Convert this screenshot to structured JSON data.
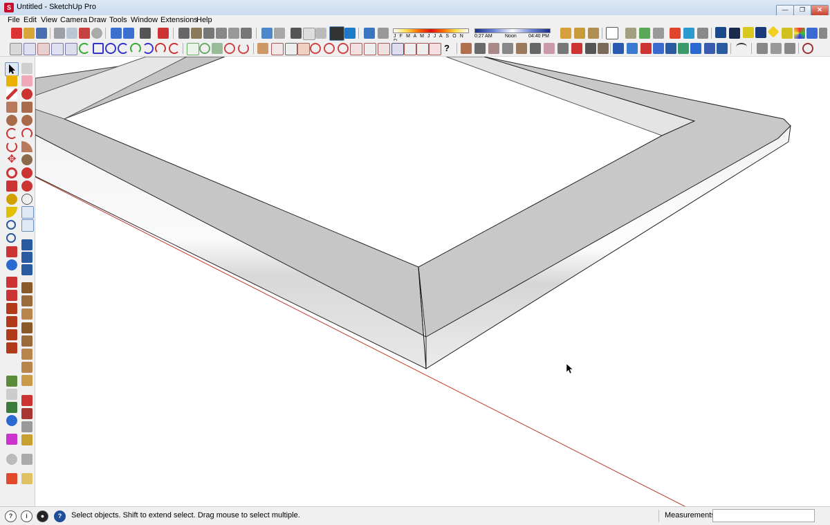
{
  "window": {
    "title": "Untitled - SketchUp Pro",
    "minimize": "—",
    "maximize": "❐",
    "close": "✕"
  },
  "menu": [
    "File",
    "Edit",
    "View",
    "Camera",
    "Draw",
    "Tools",
    "Window",
    "Extensions",
    "Help"
  ],
  "shadow": {
    "months": "J F M A M J J A S O N D",
    "time_start": "0:27 AM",
    "time_mid": "Noon",
    "time_end": "04:40 PM"
  },
  "status": {
    "hint": "Select objects. Shift to extend select. Drag mouse to select multiple.",
    "measurements_label": "Measurements",
    "measurements_value": "",
    "icon_info": "i",
    "icon_help": "?"
  },
  "icons": {
    "select": "arrow-icon",
    "cursor": "pointer-cursor-icon"
  },
  "colors": {
    "frame_top": "#c6c6c6",
    "frame_front": "#f0f0f0",
    "inner_edge": "#e6e6e6",
    "axis_red": "#c0392b"
  }
}
